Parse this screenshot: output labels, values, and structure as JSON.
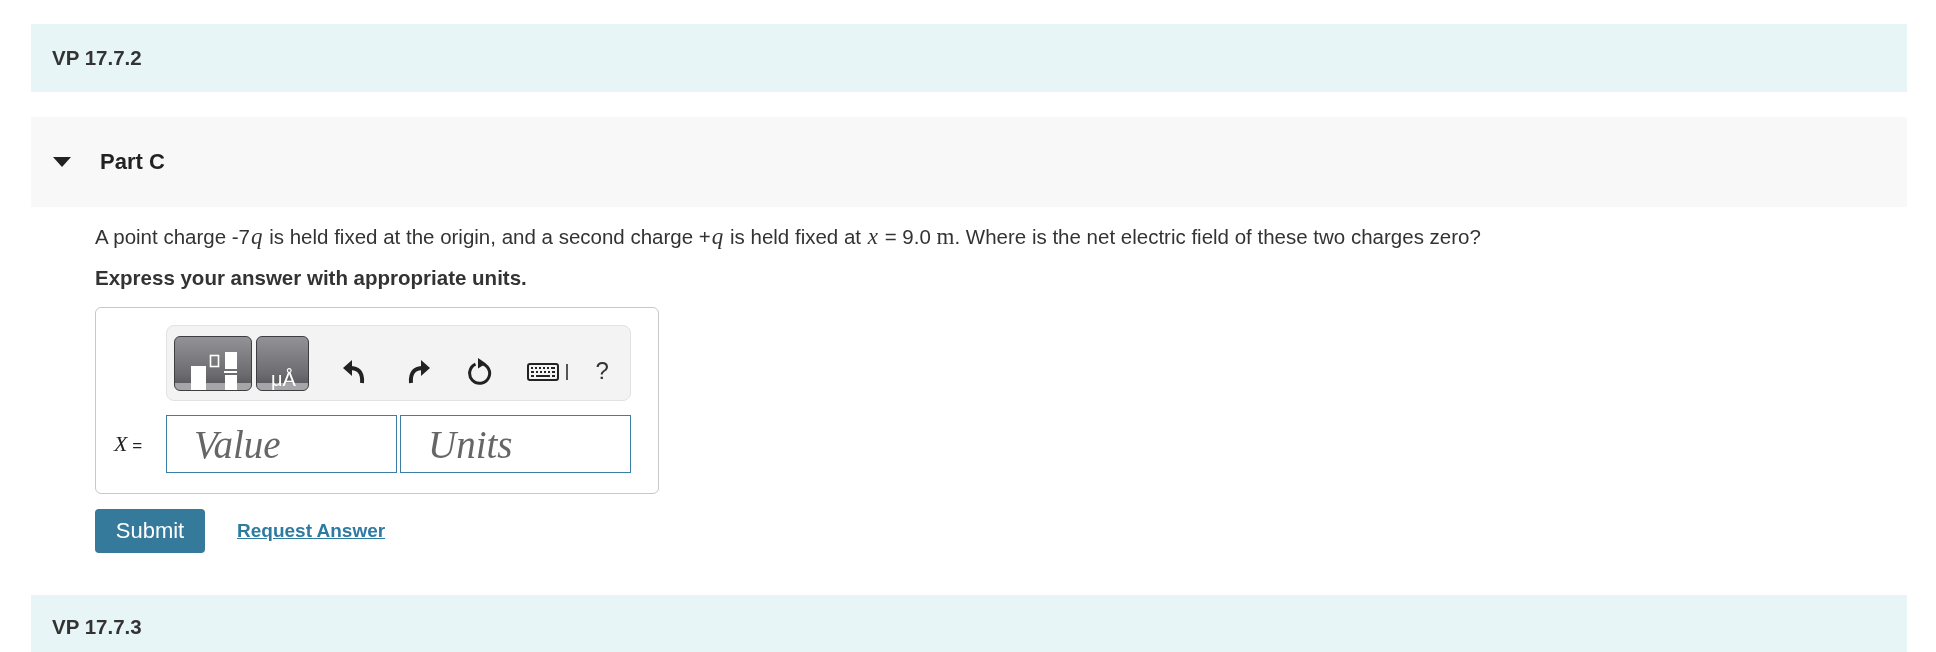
{
  "problem_header": {
    "title": "VP 17.7.2"
  },
  "part": {
    "title": "Part C",
    "expanded": true,
    "question": [
      {
        "kind": "plain",
        "text": "A point charge -7"
      },
      {
        "kind": "math",
        "text": "q"
      },
      {
        "kind": "plain",
        "text": " is held fixed at the origin, and a second charge +"
      },
      {
        "kind": "math",
        "text": "q"
      },
      {
        "kind": "plain",
        "text": " is held fixed at "
      },
      {
        "kind": "math",
        "text": "x"
      },
      {
        "kind": "plain",
        "text": " = 9.0 "
      },
      {
        "kind": "unit",
        "text": "m"
      },
      {
        "kind": "plain",
        "text": ". Where is the net electric field of these two charges zero?"
      }
    ],
    "instruction": "Express your answer with appropriate units.",
    "answer": {
      "toolbar": [
        {
          "kind": "templates"
        },
        {
          "kind": "units",
          "label": "μÅ"
        },
        {
          "kind": "undo"
        },
        {
          "kind": "redo"
        },
        {
          "kind": "reset"
        },
        {
          "kind": "keyboard"
        },
        {
          "kind": "help",
          "label": "?"
        }
      ],
      "label": "*X* =",
      "value_field": {
        "placeholder": "Value"
      },
      "units_field": {
        "placeholder": "Units"
      }
    },
    "buttons": [
      {
        "kind": "primary",
        "label": "Submit"
      },
      {
        "kind": "link",
        "label": "Request Answer"
      }
    ]
  },
  "next_problem_header": {
    "title": "VP 17.7.3"
  }
}
